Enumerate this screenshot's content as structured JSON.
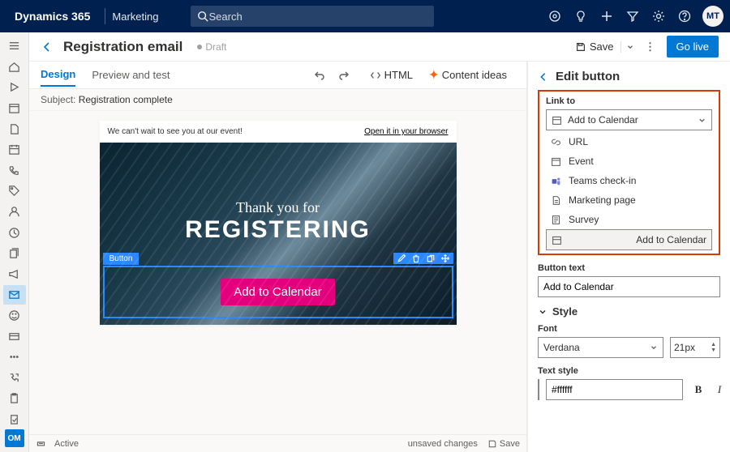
{
  "topbar": {
    "brand": "Dynamics 365",
    "app": "Marketing",
    "search_placeholder": "Search",
    "avatar": "MT"
  },
  "leftnav": {
    "om": "OM"
  },
  "cmdbar": {
    "title": "Registration email",
    "status": "Draft",
    "save": "Save",
    "golive": "Go live"
  },
  "tabs": {
    "design": "Design",
    "preview": "Preview and test",
    "html": "HTML",
    "ideas": "Content ideas"
  },
  "subject": {
    "label": "Subject:",
    "value": "Registration complete"
  },
  "email": {
    "preheader": "We can't wait to see you at our event!",
    "browser_link": "Open it in your browser",
    "hero_line1": "Thank you for",
    "hero_line2": "REGISTERING",
    "selected_label": "Button",
    "cta_text": "Add to Calendar"
  },
  "panel": {
    "title": "Edit button",
    "link_to_label": "Link to",
    "link_to_value": "Add to Calendar",
    "options": {
      "url": "URL",
      "event": "Event",
      "teams": "Teams check-in",
      "mpage": "Marketing page",
      "survey": "Survey",
      "calendar": "Add to Calendar"
    },
    "button_text_label": "Button text",
    "button_text_value": "Add to Calendar",
    "style_section": "Style",
    "font_label": "Font",
    "font_value": "Verdana",
    "font_size": "21px",
    "text_style_label": "Text style",
    "text_color": "#ffffff"
  },
  "footer": {
    "active": "Active",
    "unsaved": "unsaved changes",
    "save": "Save"
  }
}
